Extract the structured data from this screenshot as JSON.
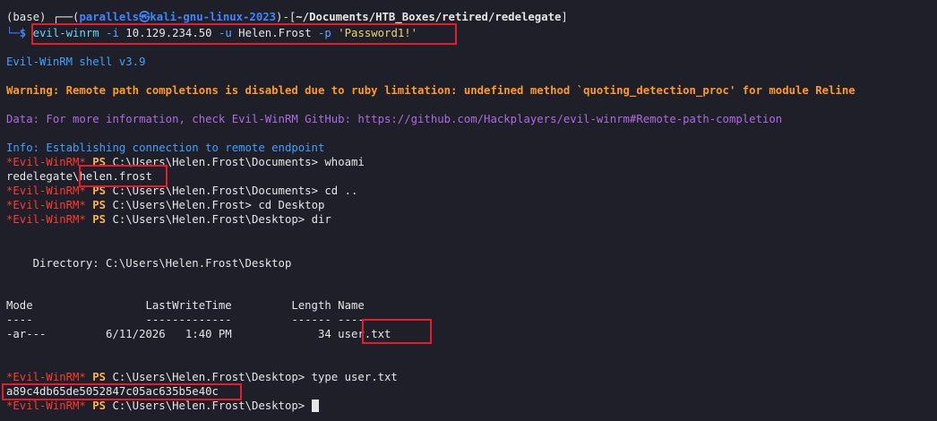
{
  "prompt": {
    "env": "(base) ",
    "corner_top": "┌──(",
    "userhost": "parallels㉿kali-gnu-linux-2023",
    "bracket_mid": ")-[",
    "cwd": "~/Documents/HTB_Boxes/retired/redelegate",
    "bracket_end": "]",
    "corner_bottom": "└─$ "
  },
  "command": {
    "tool": "evil-winrm",
    "flag_i": " -i ",
    "ip": "10.129.234.50",
    "flag_u": " -u ",
    "user": "Helen.Frost",
    "flag_p": " -p ",
    "password": "'Password1!'"
  },
  "banner": {
    "shell": "Evil-WinRM shell v3.9",
    "warning": "Warning: Remote path completions is disabled due to ruby limitation: undefined method `quoting_detection_proc' for module Reline",
    "data": "Data: For more information, check Evil-WinRM GitHub: https://github.com/Hackplayers/evil-winrm#Remote-path-completion",
    "info": "Info: Establishing connection to remote endpoint"
  },
  "ps_prompt": {
    "tag": "*Evil-WinRM*",
    "ps": " PS "
  },
  "session": {
    "p1_path": "C:\\Users\\Helen.Frost\\Documents> ",
    "p1_cmd": "whoami",
    "whoami_domain": "redelegate\\",
    "whoami_user": "helen.frost",
    "p2_path": "C:\\Users\\Helen.Frost\\Documents> ",
    "p2_cmd": "cd ..",
    "p3_path": "C:\\Users\\Helen.Frost> ",
    "p3_cmd": "cd Desktop",
    "p4_path": "C:\\Users\\Helen.Frost\\Desktop> ",
    "p4_cmd": "dir",
    "directory": "    Directory: C:\\Users\\Helen.Frost\\Desktop",
    "headers": "Mode                 LastWriteTime         Length Name",
    "underlines": "----                 -------------         ------ ----",
    "row_prefix": "-ar---         6/11/2026   1:40 PM             34 ",
    "row_file": "user.txt",
    "p5_path": "C:\\Users\\Helen.Frost\\Desktop> ",
    "p5_cmd": "type user.txt",
    "flag": "a89c4db65de5052847c05ac635b5e40c",
    "p6_path": "C:\\Users\\Helen.Frost\\Desktop> "
  },
  "colors": {
    "background": "#1e1f29",
    "highlight_box": "#e31d2b",
    "warning": "#ff9b1f",
    "data": "#b06adf",
    "info": "#3fa2ff",
    "winrm_tag": "#ff3b30"
  }
}
